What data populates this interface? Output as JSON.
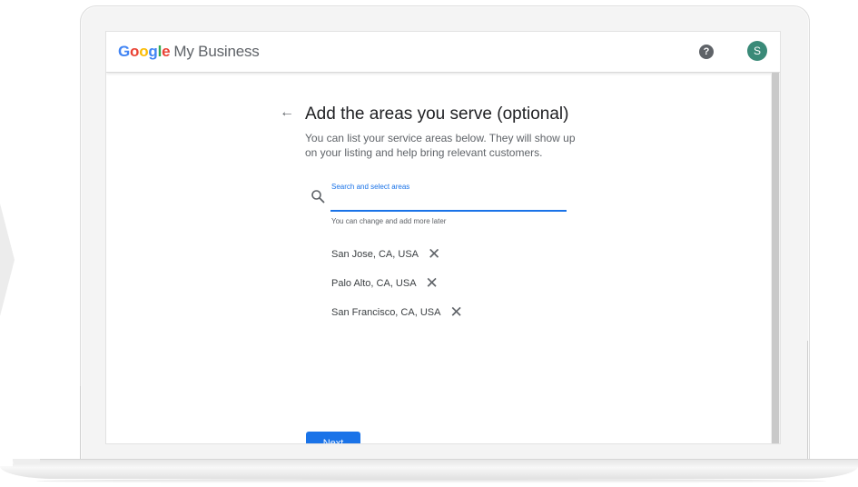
{
  "header": {
    "logo_letters": [
      "G",
      "o",
      "o",
      "g",
      "l",
      "e"
    ],
    "product_name": "My Business",
    "help_icon": "help-circle-icon",
    "help_glyph": "?",
    "avatar_initial": "S",
    "avatar_color": "#3a8a78"
  },
  "page": {
    "back_icon": "arrow-back-icon",
    "back_glyph": "←",
    "title": "Add the areas you serve (optional)",
    "description": "You can list your service areas below. They will show up on your listing and help bring relevant customers."
  },
  "search": {
    "icon": "search-icon",
    "label": "Search and select areas",
    "value": "",
    "placeholder": "",
    "helper_text": "You can change and add more later"
  },
  "areas": [
    {
      "label": "San Jose, CA, USA",
      "remove_glyph": "✕"
    },
    {
      "label": "Palo Alto, CA, USA",
      "remove_glyph": "✕"
    },
    {
      "label": "San Francisco, CA, USA",
      "remove_glyph": "✕"
    }
  ],
  "footer": {
    "next_label": "Next"
  },
  "colors": {
    "accent": "#1a73e8",
    "google_blue": "#4285F4",
    "google_red": "#EA4335",
    "google_yellow": "#FBBC05",
    "google_green": "#34A853"
  }
}
